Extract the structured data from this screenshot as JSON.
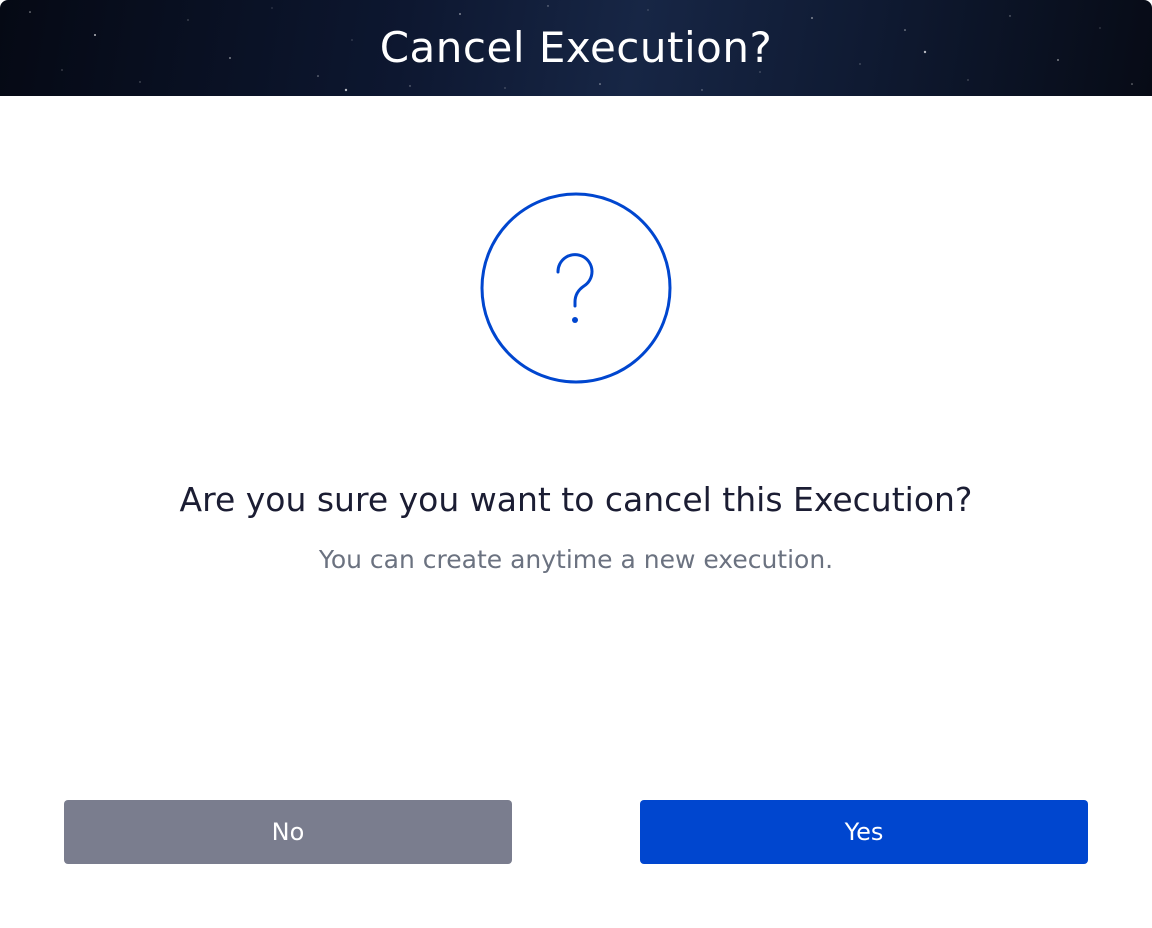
{
  "dialog": {
    "title": "Cancel Execution?",
    "question": "Are you sure you want to cancel this Execution?",
    "subtext": "You can create anytime a new execution.",
    "icon": "question-mark-circle-icon",
    "buttons": {
      "no_label": "No",
      "yes_label": "Yes"
    }
  },
  "colors": {
    "header_background": "#0d1730",
    "accent": "#0046cf",
    "secondary_button": "#7a7d8e",
    "question_text": "#1b1d33",
    "subtext": "#6b7280"
  }
}
